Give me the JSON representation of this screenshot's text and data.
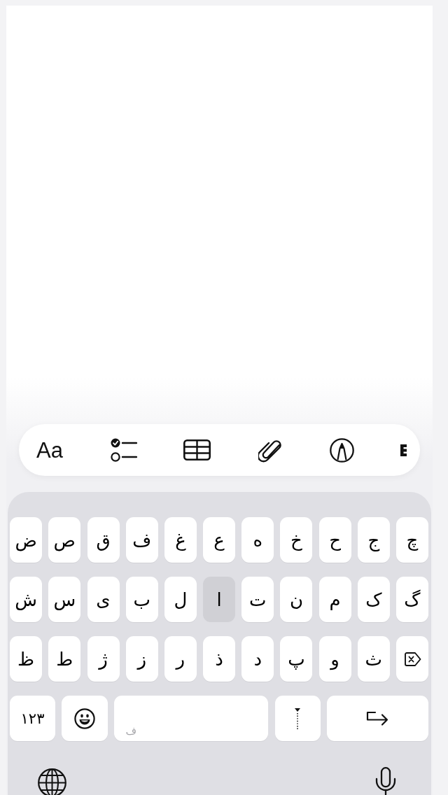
{
  "toolbar": {
    "format_label": "Aa"
  },
  "keyboard": {
    "rows": [
      {
        "keys": [
          {
            "kind": "letter",
            "label": "چ",
            "pressed": false
          },
          {
            "kind": "letter",
            "label": "ج",
            "pressed": false
          },
          {
            "kind": "letter",
            "label": "ح",
            "pressed": false
          },
          {
            "kind": "letter",
            "label": "خ",
            "pressed": false
          },
          {
            "kind": "letter",
            "label": "ه",
            "pressed": false
          },
          {
            "kind": "letter",
            "label": "ع",
            "pressed": false
          },
          {
            "kind": "letter",
            "label": "غ",
            "pressed": false
          },
          {
            "kind": "letter",
            "label": "ف",
            "pressed": false
          },
          {
            "kind": "letter",
            "label": "ق",
            "pressed": false
          },
          {
            "kind": "letter",
            "label": "ص",
            "pressed": false
          },
          {
            "kind": "letter",
            "label": "ض",
            "pressed": false
          }
        ]
      },
      {
        "keys": [
          {
            "kind": "letter",
            "label": "گ",
            "pressed": false
          },
          {
            "kind": "letter",
            "label": "ک",
            "pressed": false
          },
          {
            "kind": "letter",
            "label": "م",
            "pressed": false
          },
          {
            "kind": "letter",
            "label": "ن",
            "pressed": false
          },
          {
            "kind": "letter",
            "label": "ت",
            "pressed": false
          },
          {
            "kind": "letter",
            "label": "ا",
            "pressed": true
          },
          {
            "kind": "letter",
            "label": "ل",
            "pressed": false
          },
          {
            "kind": "letter",
            "label": "ب",
            "pressed": false
          },
          {
            "kind": "letter",
            "label": "ی",
            "pressed": false
          },
          {
            "kind": "letter",
            "label": "س",
            "pressed": false
          },
          {
            "kind": "letter",
            "label": "ش",
            "pressed": false
          }
        ]
      },
      {
        "keys": [
          {
            "kind": "delete",
            "pressed": false
          },
          {
            "kind": "letter",
            "label": "ث",
            "pressed": false
          },
          {
            "kind": "letter",
            "label": "و",
            "pressed": false
          },
          {
            "kind": "letter",
            "label": "پ",
            "pressed": false
          },
          {
            "kind": "letter",
            "label": "د",
            "pressed": false
          },
          {
            "kind": "letter",
            "label": "ذ",
            "pressed": false
          },
          {
            "kind": "letter",
            "label": "ر",
            "pressed": false
          },
          {
            "kind": "letter",
            "label": "ز",
            "pressed": false
          },
          {
            "kind": "letter",
            "label": "ژ",
            "pressed": false
          },
          {
            "kind": "letter",
            "label": "ط",
            "pressed": false
          },
          {
            "kind": "letter",
            "label": "ظ",
            "pressed": false
          }
        ]
      },
      {
        "keys": [
          {
            "kind": "return",
            "pressed": false
          },
          {
            "kind": "zwnj",
            "pressed": false
          },
          {
            "kind": "space",
            "label": "ف",
            "pressed": false
          },
          {
            "kind": "emoji",
            "pressed": false
          },
          {
            "kind": "numbers",
            "label": "۱۲۳",
            "pressed": false
          }
        ]
      }
    ]
  }
}
